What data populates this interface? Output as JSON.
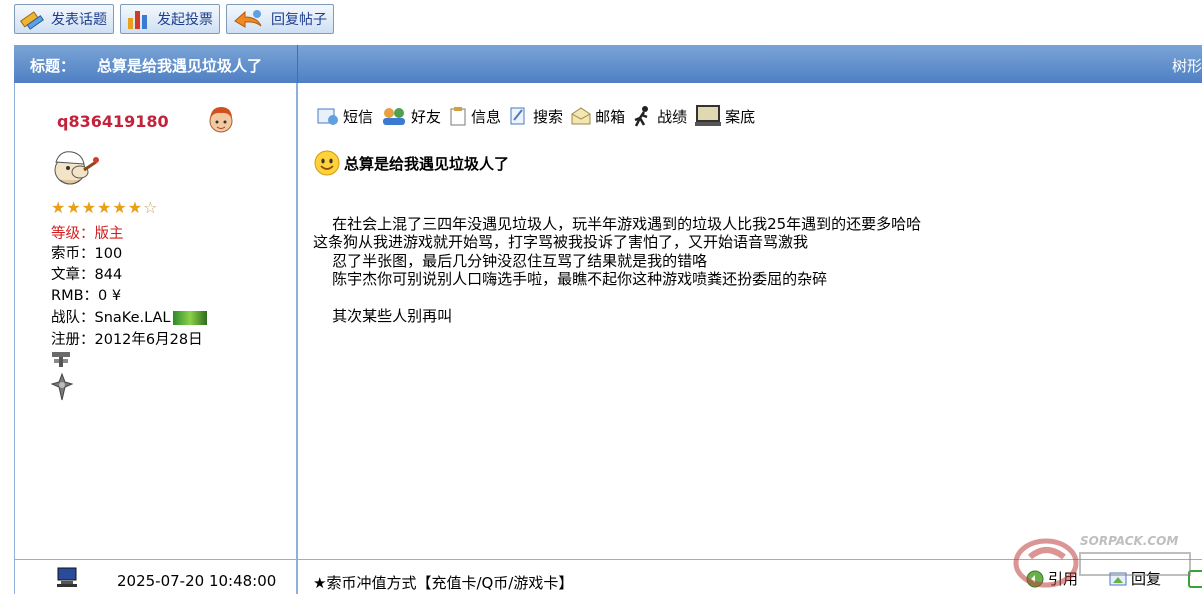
{
  "toolbar": {
    "new_topic": "发表话题",
    "new_poll": "发起投票",
    "reply_post": "回复帖子"
  },
  "titlebar": {
    "label": "标题：",
    "title": "总算是给我遇见垃圾人了",
    "view_mode": "树形"
  },
  "user": {
    "username": "q836419180",
    "level_label": "等级：",
    "level_value": "版主",
    "coins_label": "索币：",
    "coins_value": "100",
    "articles_label": "文章：",
    "articles_value": "844",
    "rmb_label": "RMB：",
    "rmb_value": "0 ¥",
    "team_label": "战队：",
    "team_value": "SnaKe.LAL",
    "register_label": "注册：",
    "register_value": "2012年6月28日",
    "stars_filled": 6,
    "stars_total": 7
  },
  "actions": {
    "message": "短信",
    "friend": "好友",
    "info": "信息",
    "search": "搜索",
    "mailbox": "邮箱",
    "record": "战绩",
    "case": "案底"
  },
  "post": {
    "title": "总算是给我遇见垃圾人了",
    "line1": "    在社会上混了三四年没遇见垃圾人，玩半年游戏遇到的垃圾人比我25年遇到的还要多哈哈",
    "line2": "这条狗从我进游戏就开始骂，打字骂被我投诉了害怕了，又开始语音骂激我",
    "line3": "    忍了半张图，最后几分钟没忍住互骂了结果就是我的错咯",
    "line4": "    陈宇杰你可别说别人口嗨选手啦，最瞧不起你这种游戏喷粪还扮委屈的杂碎",
    "line5": "",
    "line6": "    其次某些人别再叫"
  },
  "footer": {
    "date": "2025-07-20 10:48:00",
    "ad": "★索币冲值方式【充值卡/Q币/游戏卡】",
    "quote": "引用",
    "reply": "回复"
  },
  "watermark": {
    "text": "SORPACK.COM"
  },
  "colors": {
    "title_bar": "#5a8ac9",
    "username": "#c2223a",
    "level": "#d41e1e",
    "border": "#8fb0d8"
  }
}
